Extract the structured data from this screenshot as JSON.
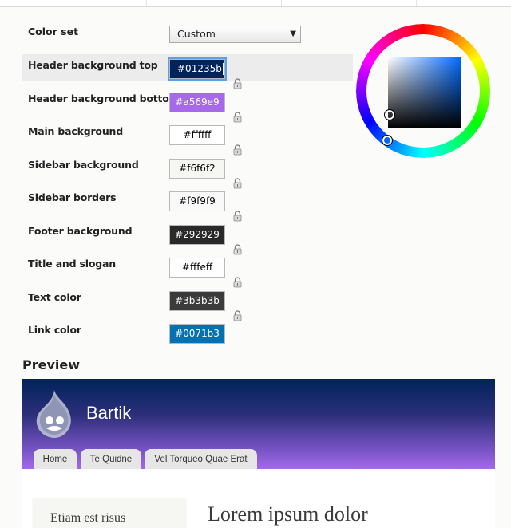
{
  "form": {
    "color_set_label": "Color set",
    "color_set_value": "Custom",
    "fields": [
      {
        "label": "Header background top",
        "value": "#01235b",
        "bg": "#01235b",
        "fg": "#ffffff",
        "active": true
      },
      {
        "label": "Header background bottom",
        "value": "#a569e9",
        "bg": "#a569e9",
        "fg": "#ffffff"
      },
      {
        "label": "Main background",
        "value": "#ffffff",
        "bg": "#ffffff",
        "fg": "#000000"
      },
      {
        "label": "Sidebar background",
        "value": "#f6f6f2",
        "bg": "#f6f6f2",
        "fg": "#000000"
      },
      {
        "label": "Sidebar borders",
        "value": "#f9f9f9",
        "bg": "#f9f9f9",
        "fg": "#000000"
      },
      {
        "label": "Footer background",
        "value": "#292929",
        "bg": "#292929",
        "fg": "#ffffff"
      },
      {
        "label": "Title and slogan",
        "value": "#fffeff",
        "bg": "#fffeff",
        "fg": "#000000"
      },
      {
        "label": "Text color",
        "value": "#3b3b3b",
        "bg": "#3b3b3b",
        "fg": "#ffffff"
      },
      {
        "label": "Link color",
        "value": "#0071b3",
        "bg": "#0071b3",
        "fg": "#ffffff"
      }
    ]
  },
  "preview": {
    "heading": "Preview",
    "site_name": "Bartik",
    "tabs": [
      "Home",
      "Te Quidne",
      "Vel Torqueo Quae Erat"
    ],
    "sidebar_text": "Etiam est risus",
    "main_title": "Lorem ipsum dolor"
  }
}
